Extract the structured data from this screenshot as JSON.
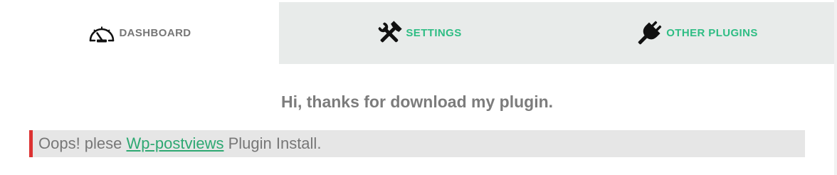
{
  "tabs": [
    {
      "label": "DASHBOARD",
      "icon": "dashboard-gauge-icon",
      "active": true
    },
    {
      "label": "SETTINGS",
      "icon": "wrench-hammer-icon",
      "active": false
    },
    {
      "label": "OTHER PLUGINS",
      "icon": "plug-icon",
      "active": false
    }
  ],
  "main": {
    "headline": "Hi, thanks for download my plugin.",
    "notice": {
      "prefix": "Oops! plese",
      "link": "Wp-postviews",
      "suffix": "Plugin Install."
    }
  },
  "colors": {
    "accent": "#2ebd84",
    "link": "#2ea872",
    "notice_border": "#dc3232",
    "notice_bg": "#e6e6e6",
    "tab_bar_bg": "#e8ebea",
    "active_tab_text": "#767676"
  }
}
